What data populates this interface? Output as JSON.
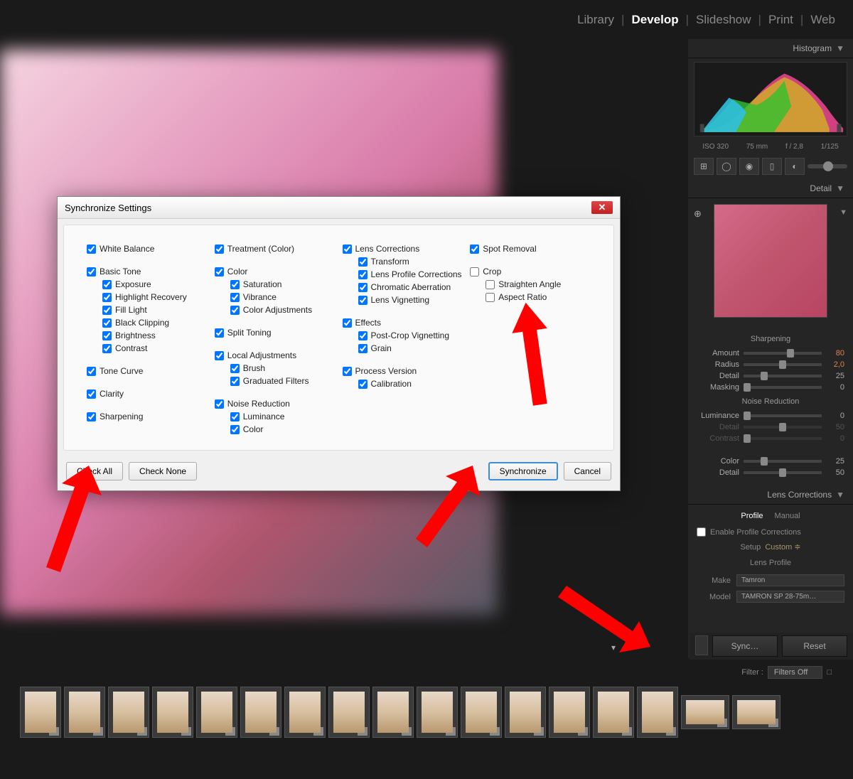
{
  "nav": {
    "library": "Library",
    "develop": "Develop",
    "slideshow": "Slideshow",
    "print": "Print",
    "web": "Web"
  },
  "dialog": {
    "title": "Synchronize Settings",
    "col1": {
      "white_balance": "White Balance",
      "basic_tone": "Basic Tone",
      "exposure": "Exposure",
      "highlight_recovery": "Highlight Recovery",
      "fill_light": "Fill Light",
      "black_clipping": "Black Clipping",
      "brightness": "Brightness",
      "contrast": "Contrast",
      "tone_curve": "Tone Curve",
      "clarity": "Clarity",
      "sharpening": "Sharpening"
    },
    "col2": {
      "treatment": "Treatment (Color)",
      "color": "Color",
      "saturation": "Saturation",
      "vibrance": "Vibrance",
      "color_adjustments": "Color Adjustments",
      "split_toning": "Split Toning",
      "local_adjustments": "Local Adjustments",
      "brush": "Brush",
      "graduated_filters": "Graduated Filters",
      "noise_reduction": "Noise Reduction",
      "luminance": "Luminance",
      "nr_color": "Color"
    },
    "col3": {
      "lens_corrections": "Lens Corrections",
      "transform": "Transform",
      "lens_profile": "Lens Profile Corrections",
      "chromatic": "Chromatic Aberration",
      "lens_vignetting": "Lens Vignetting",
      "effects": "Effects",
      "post_crop": "Post-Crop Vignetting",
      "grain": "Grain",
      "process_version": "Process Version",
      "calibration": "Calibration"
    },
    "col4": {
      "spot_removal": "Spot Removal",
      "crop": "Crop",
      "straighten": "Straighten Angle",
      "aspect": "Aspect Ratio"
    },
    "buttons": {
      "check_all": "Check All",
      "check_none": "Check None",
      "sync": "Synchronize",
      "cancel": "Cancel"
    }
  },
  "right": {
    "histogram_label": "Histogram",
    "meta": {
      "iso": "ISO 320",
      "focal": "75 mm",
      "aperture": "f / 2,8",
      "shutter": "1/125"
    },
    "detail_label": "Detail",
    "sharpening": {
      "title": "Sharpening",
      "amount_label": "Amount",
      "amount_val": "80",
      "radius_label": "Radius",
      "radius_val": "2,0",
      "detail_label": "Detail",
      "detail_val": "25",
      "masking_label": "Masking",
      "masking_val": "0"
    },
    "nr": {
      "title": "Noise Reduction",
      "luminance_label": "Luminance",
      "luminance_val": "0",
      "detail_label": "Detail",
      "detail_val": "50",
      "contrast_label": "Contrast",
      "contrast_val": "0",
      "color_label": "Color",
      "color_val": "25",
      "color_detail_label": "Detail",
      "color_detail_val": "50"
    },
    "lens": {
      "title": "Lens Corrections",
      "profile_tab": "Profile",
      "manual_tab": "Manual",
      "enable": "Enable Profile Corrections",
      "setup_label": "Setup",
      "setup_val": "Custom  ≑",
      "profile_title": "Lens Profile",
      "make_label": "Make",
      "make_val": "Tamron",
      "model_label": "Model",
      "model_val": "TAMRON SP 28-75m…"
    },
    "sync_btn": "Sync…",
    "reset_btn": "Reset"
  },
  "filter": {
    "label": "Filter :",
    "value": "Filters Off"
  }
}
